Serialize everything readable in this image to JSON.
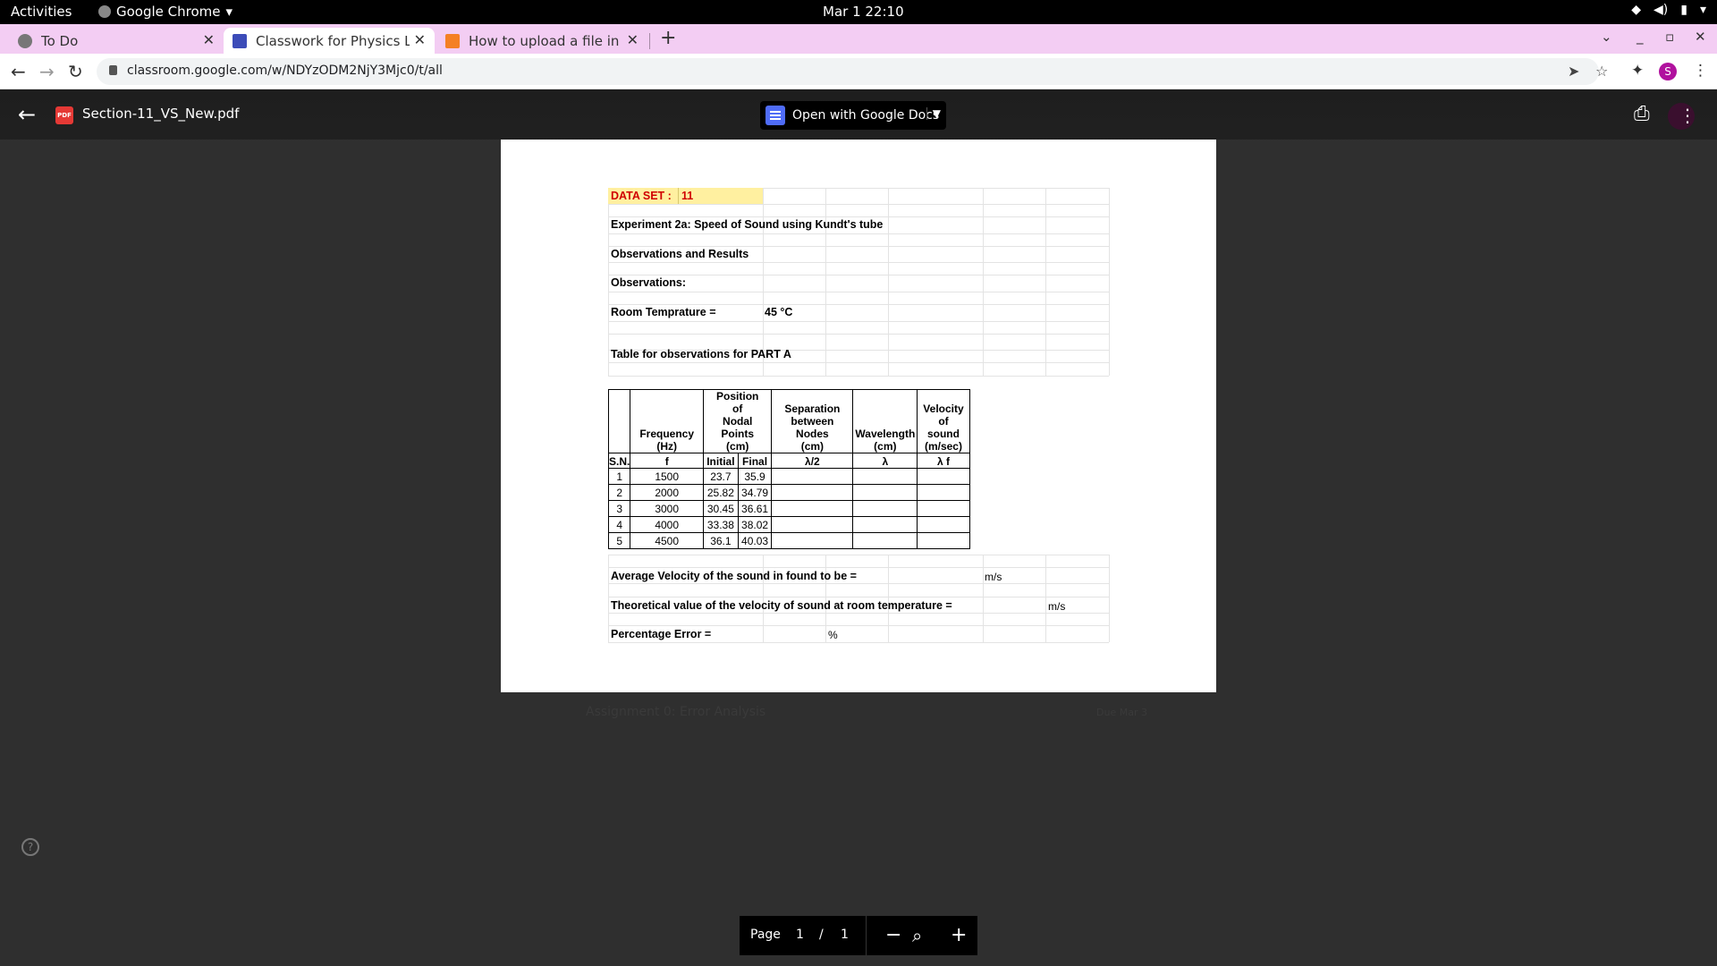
{
  "topbar": {
    "activities": "Activities",
    "app_name": "Google Chrome",
    "clock": "Mar 1  22:10"
  },
  "tabs": [
    {
      "title": "To Do",
      "active": false,
      "icon": "todo-icon"
    },
    {
      "title": "Classwork for Physics Lab",
      "active": true,
      "icon": "classroom-icon"
    },
    {
      "title": "How to upload a file in Dj",
      "active": false,
      "icon": "stackoverflow-icon"
    }
  ],
  "address_bar": {
    "url": "classroom.google.com/w/NDYzODM2NjY3Mjc0/t/all",
    "profile_initial": "S"
  },
  "viewer": {
    "filename": "Section-11_VS_New.pdf",
    "open_with": "Open with Google Docs",
    "pdf_badge": "PDF"
  },
  "background": {
    "assignment": "Assignment 0: Error Analysis",
    "due": "Due Mar 3"
  },
  "sheet": {
    "dataset_label": "DATA SET :",
    "dataset_value": "11",
    "experiment": "Experiment 2a: Speed of Sound using Kundt's tube",
    "obs_results": "Observations and Results",
    "observations": "Observations:",
    "room_temp_label": "Room Temprature =",
    "room_temp_value": "45 °C",
    "table_title": "Table for observations for PART A",
    "headers": {
      "sn": "S.N.",
      "freq": "Frequency (Hz)",
      "freq_sym": "f",
      "position": "Position of Nodal Points (cm)",
      "initial": "Initial",
      "final": "Final",
      "separation": "Separation between Nodes (cm)",
      "separation_sym": "λ/2",
      "wavelength": "Wavelength (cm)",
      "wavelength_sym": "λ",
      "velocity": "Velocity of sound (m/sec)",
      "velocity_sym": "λ f"
    },
    "rows": [
      {
        "sn": "1",
        "f": "1500",
        "initial": "23.7",
        "final": "35.9"
      },
      {
        "sn": "2",
        "f": "2000",
        "initial": "25.82",
        "final": "34.79"
      },
      {
        "sn": "3",
        "f": "3000",
        "initial": "30.45",
        "final": "36.61"
      },
      {
        "sn": "4",
        "f": "4000",
        "initial": "33.38",
        "final": "38.02"
      },
      {
        "sn": "5",
        "f": "4500",
        "initial": "36.1",
        "final": "40.03"
      }
    ],
    "avg_velocity": "Average Velocity of the sound in found to be =",
    "avg_unit": "m/s",
    "theoretical": "Theoretical value of the velocity of sound at room temperature =",
    "theoretical_unit": "m/s",
    "pct_error": "Percentage Error =",
    "pct_unit": "%"
  },
  "pagebar": {
    "page_label": "Page",
    "current": "1",
    "slash": "/",
    "total": "1"
  },
  "help": "?"
}
